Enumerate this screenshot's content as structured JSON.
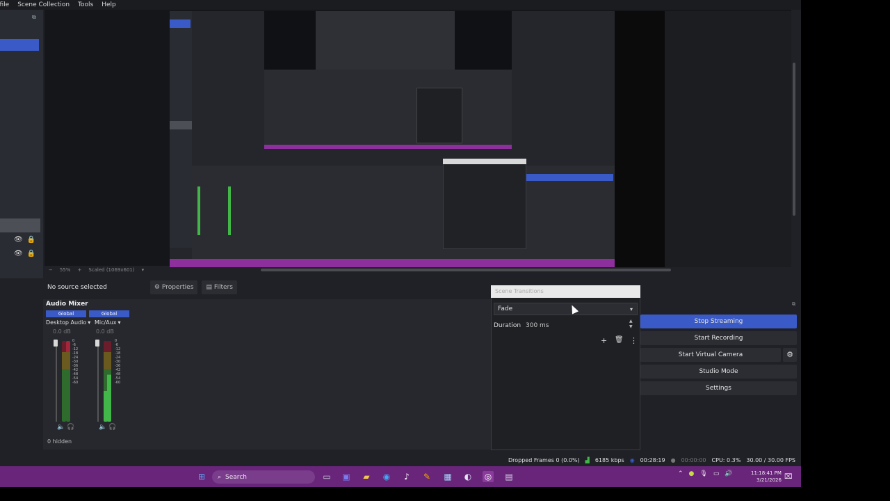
{
  "menu": [
    "ofile",
    "Scene Collection",
    "Tools",
    "Help"
  ],
  "preview": {
    "zoom": "55%",
    "scaled": "Scaled (1069x601)"
  },
  "properties_bar": {
    "no_source": "No source selected",
    "properties_label": "Properties",
    "filters_label": "Filters"
  },
  "audio_mixer": {
    "title": "Audio Mixer",
    "channels": [
      {
        "global": "Global",
        "name": "Desktop Audio",
        "db": "0.0 dB"
      },
      {
        "global": "Global",
        "name": "Mic/Aux",
        "db": "0.0 dB"
      }
    ],
    "scale": [
      "0",
      "-6",
      "-12",
      "-18",
      "-24",
      "-30",
      "-36",
      "-42",
      "-48",
      "-54",
      "-60"
    ],
    "hidden": "0 hidden"
  },
  "scene_transitions": {
    "title": "Scene Transitions",
    "selected": "Fade",
    "duration_label": "Duration",
    "duration_value": "300 ms"
  },
  "controls": {
    "stop_streaming": "Stop Streaming",
    "start_recording": "Start Recording",
    "start_virtual_camera": "Start Virtual Camera",
    "studio_mode": "Studio Mode",
    "settings": "Settings"
  },
  "stats": {
    "dropped": "Dropped Frames 0 (0.0%)",
    "kbps": "6185 kbps",
    "stream_time": "00:28:19",
    "rec_time": "00:00:00",
    "cpu": "CPU: 0.3%",
    "fps": "30.00 / 30.00 FPS"
  },
  "taskbar": {
    "search": "Search",
    "time": "11:18:41 PM",
    "date": "3/21/2026"
  },
  "colors": {
    "accent": "#3a5ac7",
    "taskbar": "#68257a",
    "meter_green": "#43b649",
    "meter_red": "#a3263a"
  }
}
